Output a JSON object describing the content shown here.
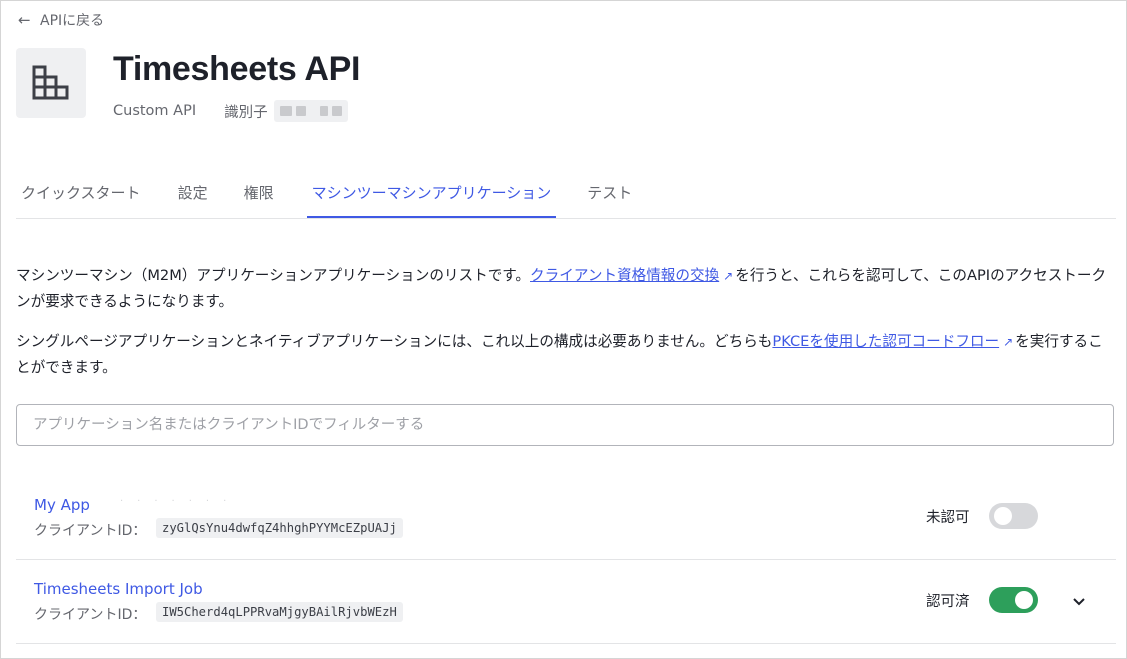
{
  "back": {
    "label": "APIに戻る"
  },
  "api": {
    "title": "Timesheets API",
    "type": "Custom API",
    "identifier_label": "識別子"
  },
  "tabs": [
    {
      "label": "クイックスタート",
      "active": false
    },
    {
      "label": "設定",
      "active": false
    },
    {
      "label": "権限",
      "active": false
    },
    {
      "label": "マシンツーマシンアプリケーション",
      "active": true
    },
    {
      "label": "テスト",
      "active": false
    }
  ],
  "intro": {
    "p1_before": "マシンツーマシン（M2M）アプリケーションアプリケーションのリストです。",
    "p1_link": "クライアント資格情報の交換",
    "p1_after": "を行うと、これらを認可して、このAPIのアクセストークンが要求できるようになります。",
    "p2_before": "シングルページアプリケーションとネイティブアプリケーションには、これ以上の構成は必要ありません。どちらも",
    "p2_link": "PKCEを使用した認可コードフロー",
    "p2_after": "を実行することができます。"
  },
  "filter": {
    "placeholder": "アプリケーション名またはクライアントIDでフィルターする",
    "value": ""
  },
  "apps": [
    {
      "name": "My App",
      "client_id_label": "クライアントID：",
      "client_id": "zyGlQsYnu4dwfqZ4hhghPYYMcEZpUAJj",
      "status": "未認可",
      "authorized": false
    },
    {
      "name": "Timesheets Import Job",
      "client_id_label": "クライアントID：",
      "client_id": "IW5Cherd4qLPPRvaMjgyBAilRjvbWEzH",
      "status": "認可済",
      "authorized": true
    }
  ],
  "colors": {
    "accent": "#3f59e4",
    "toggle_on": "#2d9f5b",
    "toggle_off": "#d7d8db"
  }
}
